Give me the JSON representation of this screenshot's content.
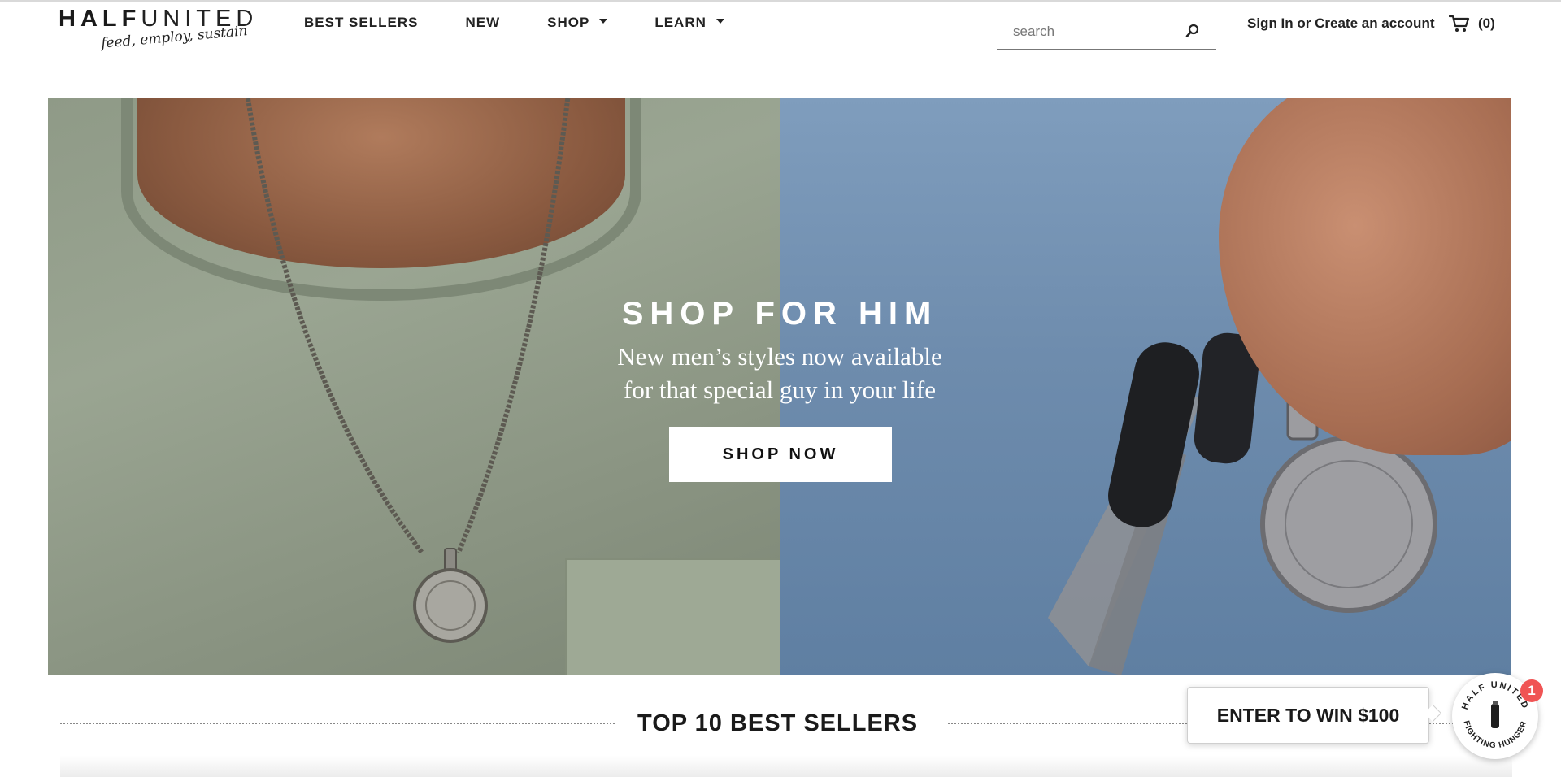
{
  "brand": {
    "name_bold": "HALF",
    "name_light": "UNITED",
    "tagline": "feed, employ, sustain"
  },
  "nav": {
    "items": [
      {
        "label": "BEST SELLERS",
        "has_dropdown": false
      },
      {
        "label": "NEW",
        "has_dropdown": false
      },
      {
        "label": "SHOP",
        "has_dropdown": true
      },
      {
        "label": "LEARN",
        "has_dropdown": true
      }
    ]
  },
  "search": {
    "placeholder": "search",
    "value": "",
    "icon": "search-icon"
  },
  "account": {
    "label": "Sign In or Create an account"
  },
  "cart": {
    "icon": "cart-icon",
    "count_label": "(0)"
  },
  "hero": {
    "title": "SHOP FOR HIM",
    "subtitle_line1": "New men’s styles now available",
    "subtitle_line2": "for that special guy in your life",
    "cta_label": "SHOP NOW"
  },
  "section": {
    "title": "TOP 10 BEST SELLERS"
  },
  "promo": {
    "popup_label": "ENTER TO WIN $100",
    "badge_ring_top": "HALF UNITED",
    "badge_ring_bottom": "FIGHTING HUNGER",
    "notification_count": "1"
  },
  "colors": {
    "notification": "#f05454",
    "text": "#1a1a1a"
  }
}
